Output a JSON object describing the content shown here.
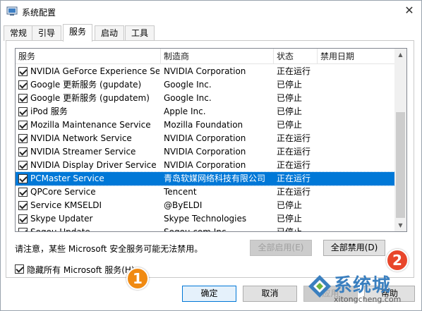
{
  "window": {
    "title": "系统配置",
    "close_glyph": "✕"
  },
  "tabs": [
    {
      "label": "常规",
      "active": false
    },
    {
      "label": "引导",
      "active": false
    },
    {
      "label": "服务",
      "active": true
    },
    {
      "label": "启动",
      "active": false
    },
    {
      "label": "工具",
      "active": false
    }
  ],
  "services_table": {
    "columns": [
      "服务",
      "制造商",
      "状态",
      "禁用日期"
    ],
    "rows": [
      {
        "name": "NVIDIA GeForce Experience Serv...",
        "vendor": "NVIDIA Corporation",
        "status": "正在运行",
        "checked": true,
        "selected": false
      },
      {
        "name": "Google 更新服务 (gupdate)",
        "vendor": "Google Inc.",
        "status": "已停止",
        "checked": true,
        "selected": false
      },
      {
        "name": "Google 更新服务 (gupdatem)",
        "vendor": "Google Inc.",
        "status": "已停止",
        "checked": true,
        "selected": false
      },
      {
        "name": "iPod 服务",
        "vendor": "Apple Inc.",
        "status": "已停止",
        "checked": true,
        "selected": false
      },
      {
        "name": "Mozilla Maintenance Service",
        "vendor": "Mozilla Foundation",
        "status": "已停止",
        "checked": true,
        "selected": false
      },
      {
        "name": "NVIDIA Network Service",
        "vendor": "NVIDIA Corporation",
        "status": "正在运行",
        "checked": true,
        "selected": false
      },
      {
        "name": "NVIDIA Streamer Service",
        "vendor": "NVIDIA Corporation",
        "status": "正在运行",
        "checked": true,
        "selected": false
      },
      {
        "name": "NVIDIA Display Driver Service",
        "vendor": "NVIDIA Corporation",
        "status": "正在运行",
        "checked": true,
        "selected": false
      },
      {
        "name": "PCMaster Service",
        "vendor": "青岛软媒网络科技有限公司",
        "status": "正在运行",
        "checked": true,
        "selected": true
      },
      {
        "name": "QPCore Service",
        "vendor": "Tencent",
        "status": "正在运行",
        "checked": true,
        "selected": false
      },
      {
        "name": "Service KMSELDI",
        "vendor": "@ByELDI",
        "status": "已停止",
        "checked": true,
        "selected": false
      },
      {
        "name": "Skype Updater",
        "vendor": "Skype Technologies",
        "status": "已停止",
        "checked": true,
        "selected": false
      },
      {
        "name": "Sogou Update",
        "vendor": "Sogou.com Inc.",
        "status": "已停止",
        "checked": true,
        "selected": false
      }
    ]
  },
  "notice_text": "请注意，某些 Microsoft 安全服务可能无法禁用。",
  "buttons": {
    "enable_all": "全部启用(E)",
    "disable_all": "全部禁用(D)",
    "ok": "确定",
    "cancel": "取消",
    "apply": "应用",
    "help": "帮助"
  },
  "hide_ms_checkbox": {
    "label": "隐藏所有 Microsoft 服务(H)",
    "checked": true
  },
  "annotations": [
    {
      "number": "1",
      "color": "#f08a12"
    },
    {
      "number": "2",
      "color": "#e8462b"
    }
  ],
  "watermark": {
    "name": "系统城",
    "url": "xitongcheng.com"
  },
  "colors": {
    "selection": "#0078d7",
    "watermark_blue": "#3a7fbf"
  }
}
